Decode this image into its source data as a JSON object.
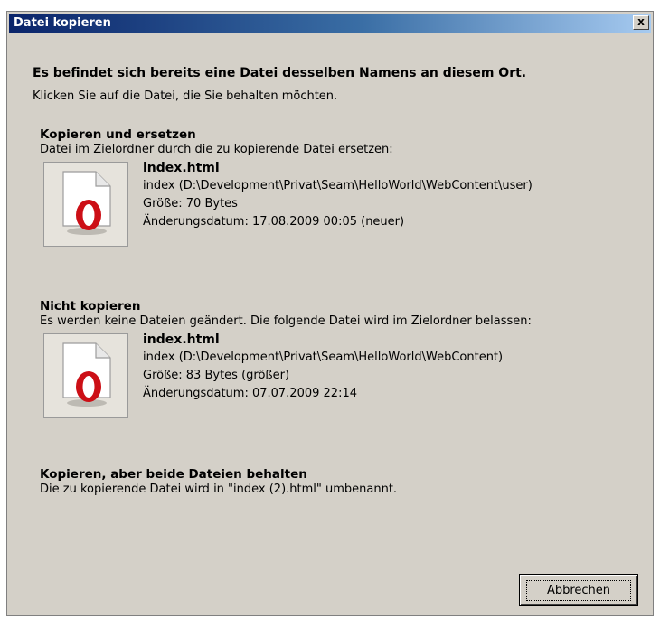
{
  "window": {
    "title": "Datei kopieren",
    "close_label": "x"
  },
  "header": {
    "heading": "Es befindet sich bereits eine Datei desselben Namens an diesem Ort.",
    "instruction": "Klicken Sie auf die Datei, die Sie behalten möchten."
  },
  "options": [
    {
      "title": "Kopieren und ersetzen",
      "description": "Datei im Zielordner durch die zu kopierende Datei ersetzen:",
      "file": {
        "name": "index.html",
        "path": "index (D:\\Development\\Privat\\Seam\\HelloWorld\\WebContent\\user)",
        "size": "Größe: 70 Bytes",
        "modified": "Änderungsdatum: 17.08.2009 00:05 (neuer)",
        "icon": "opera-html-file-icon"
      }
    },
    {
      "title": "Nicht kopieren",
      "description": "Es werden keine Dateien geändert. Die folgende Datei wird im Zielordner belassen:",
      "file": {
        "name": "index.html",
        "path": "index (D:\\Development\\Privat\\Seam\\HelloWorld\\WebContent)",
        "size": "Größe: 83 Bytes (größer)",
        "modified": "Änderungsdatum: 07.07.2009 22:14",
        "icon": "opera-html-file-icon"
      }
    },
    {
      "title": "Kopieren, aber beide Dateien behalten",
      "description": "Die zu kopierende Datei wird in \"index (2).html\" umbenannt."
    }
  ],
  "buttons": {
    "cancel": "Abbrechen"
  },
  "colors": {
    "title_bar_start": "#0a246a",
    "title_bar_end": "#a6caf0",
    "dialog_bg": "#d4d0c8",
    "opera_red": "#cc0f16"
  }
}
